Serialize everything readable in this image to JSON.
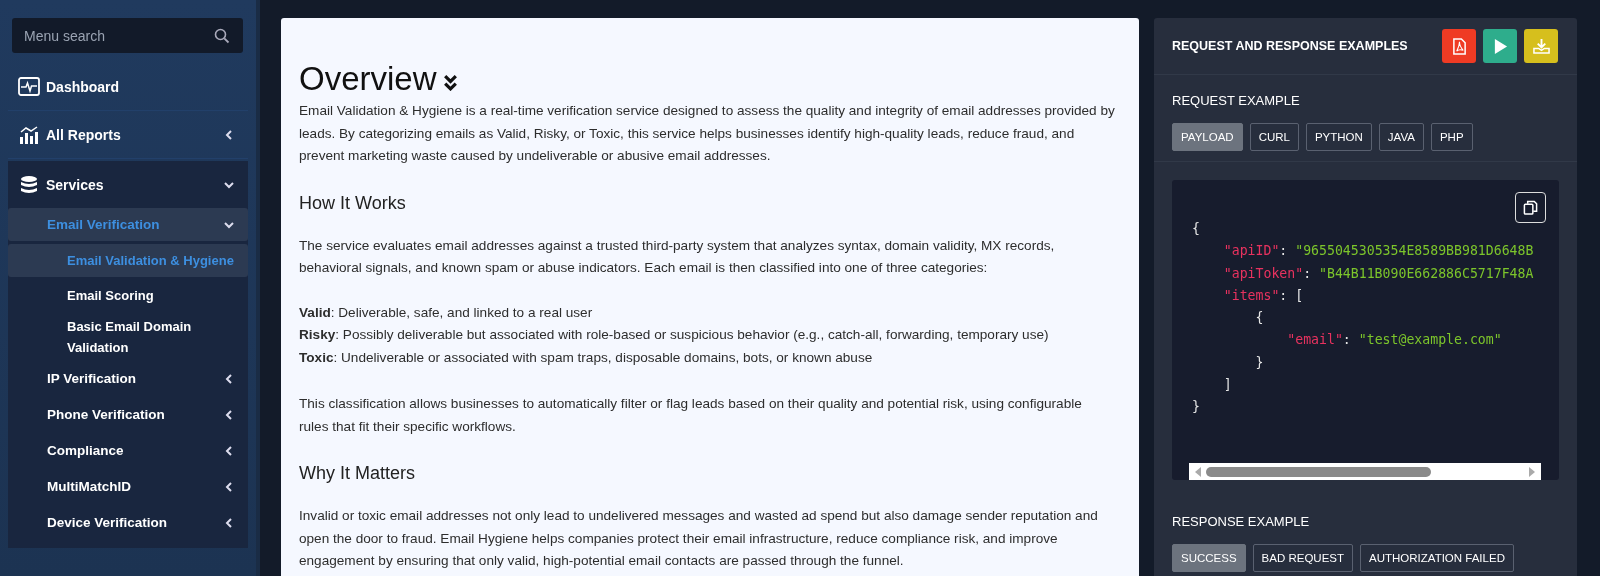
{
  "sidebar": {
    "search": {
      "placeholder": "Menu search"
    },
    "items": [
      {
        "label": "Dashboard",
        "selected": false
      },
      {
        "label": "All Reports",
        "selected": false,
        "expanded": false
      },
      {
        "label": "Services",
        "selected": false,
        "expanded": true,
        "children": [
          {
            "label": "Email Verification",
            "selected": true,
            "expanded": true,
            "children": [
              {
                "label": "Email Validation & Hygiene",
                "selected": true
              },
              {
                "label": "Email Scoring",
                "selected": false
              },
              {
                "label": "Basic Email Domain Validation",
                "selected": false
              }
            ]
          },
          {
            "label": "IP Verification",
            "selected": false,
            "expanded": false
          },
          {
            "label": "Phone Verification",
            "selected": false,
            "expanded": false
          },
          {
            "label": "Compliance",
            "selected": false,
            "expanded": false
          },
          {
            "label": "MultiMatchID",
            "selected": false,
            "expanded": false
          },
          {
            "label": "Device Verification",
            "selected": false,
            "expanded": false
          }
        ]
      }
    ]
  },
  "overview": {
    "title": "Overview",
    "intro": "Email Validation & Hygiene is a real-time verification service designed to assess the quality and integrity of email addresses provided by leads. By categorizing emails as Valid, Risky, or Toxic, this service helps businesses identify high-quality leads, reduce fraud, and prevent marketing waste caused by undeliverable or abusive email addresses.",
    "sections": [
      {
        "heading": "How It Works",
        "blocks": [
          {
            "kind": "paragraph",
            "text": "The service evaluates email addresses against a trusted third-party system that analyzes syntax, domain validity, MX records, behavioral signals, and known spam or abuse indicators. Each email is then classified into one of three categories:"
          },
          {
            "kind": "list",
            "lines": [
              "**Valid**: Deliverable, safe, and linked to a real user",
              "**Risky**: Possibly deliverable but associated with role-based or suspicious behavior (e.g., catch-all, forwarding, temporary use)",
              "**Toxic**: Undeliverable or associated with spam traps, disposable domains, bots, or known abuse"
            ]
          },
          {
            "kind": "paragraph",
            "text": "This classification allows businesses to automatically filter or flag leads based on their quality and potential risk, using configurable rules that fit their specific workflows."
          }
        ]
      },
      {
        "heading": "Why It Matters",
        "blocks": [
          {
            "kind": "paragraph",
            "text": "Invalid or toxic email addresses not only lead to undelivered messages and wasted ad spend but also damage sender reputation and open the door to fraud. Email Hygiene helps companies protect their email infrastructure, reduce compliance risk, and improve engagement by ensuring that only valid, high-potential email contacts are passed through the funnel."
          }
        ]
      }
    ]
  },
  "examples": {
    "title": "REQUEST AND RESPONSE EXAMPLES",
    "actions": [
      {
        "kind": "pdf"
      },
      {
        "kind": "run"
      },
      {
        "kind": "download"
      }
    ],
    "request": {
      "heading": "REQUEST EXAMPLE",
      "tabs": [
        {
          "label": "PAYLOAD",
          "selected": true
        },
        {
          "label": "CURL",
          "selected": false
        },
        {
          "label": "PYTHON",
          "selected": false
        },
        {
          "label": "JAVA",
          "selected": false
        },
        {
          "label": "PHP",
          "selected": false
        }
      ],
      "code": [
        [
          {
            "kind": "punct",
            "text": "{"
          }
        ],
        [
          {
            "kind": "key",
            "text": "    \"apiID\""
          },
          {
            "kind": "punct",
            "text": ": "
          },
          {
            "kind": "string",
            "text": "\"9655045305354E8589BB981D6648B"
          }
        ],
        [
          {
            "kind": "key",
            "text": "    \"apiToken\""
          },
          {
            "kind": "punct",
            "text": ": "
          },
          {
            "kind": "string",
            "text": "\"B44B11B090E662886C5717F48A"
          }
        ],
        [
          {
            "kind": "key",
            "text": "    \"items\""
          },
          {
            "kind": "punct",
            "text": ": ["
          }
        ],
        [
          {
            "kind": "punct",
            "text": "        {"
          }
        ],
        [
          {
            "kind": "key",
            "text": "            \"email\""
          },
          {
            "kind": "punct",
            "text": ": "
          },
          {
            "kind": "string",
            "text": "\"test@example.com\""
          }
        ],
        [
          {
            "kind": "punct",
            "text": "        }"
          }
        ],
        [
          {
            "kind": "punct",
            "text": "    ]"
          }
        ],
        [
          {
            "kind": "punct",
            "text": "}"
          }
        ]
      ]
    },
    "response": {
      "heading": "RESPONSE EXAMPLE",
      "tabs": [
        {
          "label": "SUCCESS",
          "selected": true
        },
        {
          "label": "BAD REQUEST",
          "selected": false
        },
        {
          "label": "AUTHORIZATION FAILED",
          "selected": false
        }
      ]
    }
  }
}
